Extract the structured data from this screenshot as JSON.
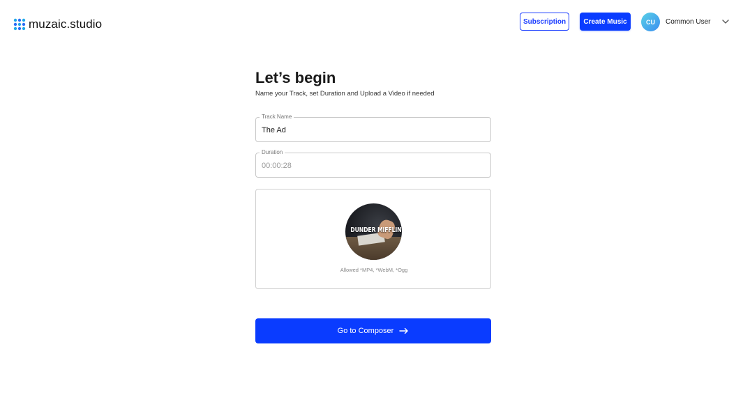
{
  "header": {
    "brand": "muzaic.studio",
    "subscription_label": "Subscription",
    "create_label": "Create Music",
    "avatar_initials": "CU",
    "username": "Common User",
    "accent_color": "#0a3cff"
  },
  "intro": {
    "title": "Let’s begin",
    "subtitle": "Name your Track, set Duration and Upload a Video if needed"
  },
  "form": {
    "track_name": {
      "label": "Track Name",
      "value": "The Ad"
    },
    "duration": {
      "label": "Duration",
      "value": "00:00:28"
    },
    "upload": {
      "thumbnail_text": "DUNDER MIFFLIN",
      "allowed_formats": "Allowed *MP4, *WebM, *Ogg"
    }
  },
  "actions": {
    "go_label": "Go to Composer"
  }
}
